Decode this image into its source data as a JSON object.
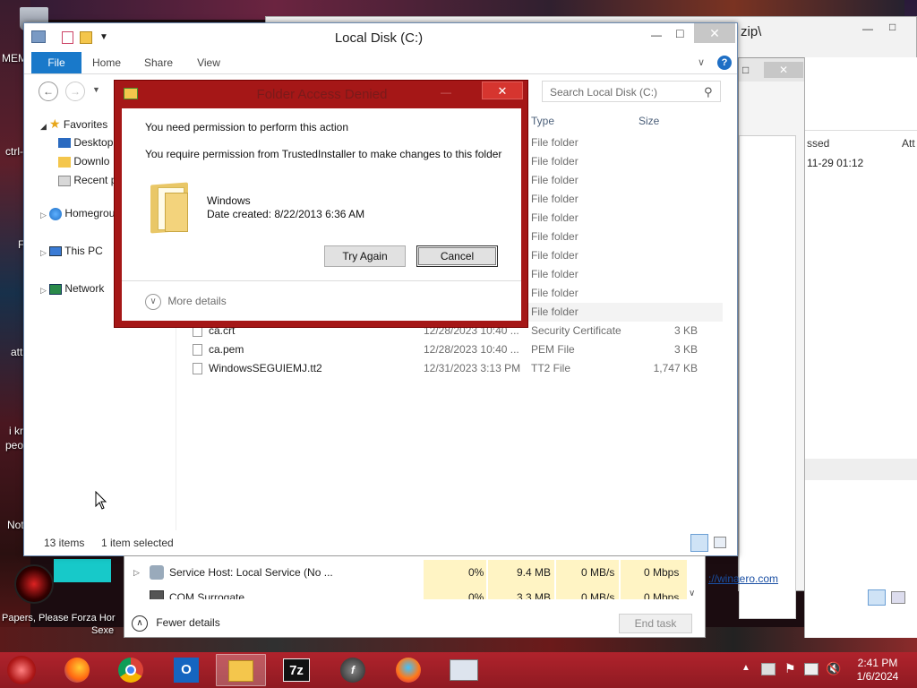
{
  "desktop": {
    "labels": [
      "MEM",
      "ctrl-",
      "F",
      "i kr",
      "peo",
      "Not",
      "att"
    ],
    "recycle_label": "",
    "wallpaper_text": "Papers, Please Forza Hor",
    "wallpaper_text2": "Sexe"
  },
  "bg_window": {
    "title_fragment": "zip\\",
    "col_accessed": "ssed",
    "col_attr": "Att",
    "row_date": "11-29 01:12",
    "link": "://winaero.com"
  },
  "explorer": {
    "title": "Local Disk (C:)",
    "ribbon_tabs": [
      "File",
      "Home",
      "Share",
      "View"
    ],
    "search_placeholder": "Search Local Disk (C:)",
    "nav": {
      "favorites": "Favorites",
      "desktop": "Desktop",
      "downloads": "Downlo",
      "recent": "Recent p",
      "homegroup": "Homegrou",
      "thispc": "This PC",
      "network": "Network"
    },
    "columns": {
      "type": "Type",
      "size": "Size"
    },
    "folder_rows": [
      "File folder",
      "File folder",
      "File folder",
      "File folder",
      "File folder",
      "File folder",
      "File folder",
      "File folder",
      "File folder",
      "File folder"
    ],
    "files": [
      {
        "name": "ca.crt",
        "date": "12/28/2023 10:40 ...",
        "type": "Security Certificate",
        "size": "3 KB"
      },
      {
        "name": "ca.pem",
        "date": "12/28/2023 10:40 ...",
        "type": "PEM File",
        "size": "3 KB"
      },
      {
        "name": "WindowsSEGUIEMJ.tt2",
        "date": "12/31/2023 3:13 PM",
        "type": "TT2 File",
        "size": "1,747 KB"
      }
    ],
    "status_items": "13 items",
    "status_selected": "1 item selected"
  },
  "dialog": {
    "title": "Folder Access Denied",
    "heading": "You need permission to perform this action",
    "message": "You require permission from TrustedInstaller to make changes to this folder",
    "item_name": "Windows",
    "item_date": "Date created: 8/22/2013 6:36 AM",
    "try_again": "Try Again",
    "cancel": "Cancel",
    "more_details": "More details"
  },
  "taskmgr": {
    "rows": [
      {
        "name": "Service Host: Local Service (No ...",
        "cpu": "0%",
        "mem": "9.4 MB",
        "disk": "0 MB/s",
        "net": "0 Mbps"
      },
      {
        "name": "COM Surrogate",
        "cpu": "0%",
        "mem": "3.3 MB",
        "disk": "0 MB/s",
        "net": "0 Mbps"
      }
    ],
    "fewer_details": "Fewer details",
    "end_task": "End task"
  },
  "taskbar": {
    "time": "2:41 PM",
    "date": "1/6/2024",
    "apps": [
      "firefox-icon",
      "chrome-icon",
      "outlook-icon",
      "file-explorer-icon",
      "7zip-icon",
      "flash-icon",
      "firefox-dev-icon",
      "task-manager-icon"
    ],
    "sevenzip_label": "7z"
  },
  "colors": {
    "accent": "#1979ca",
    "dialog_border": "#a51717",
    "taskbar": "#a51e27",
    "highlight": "#fff4c4"
  }
}
